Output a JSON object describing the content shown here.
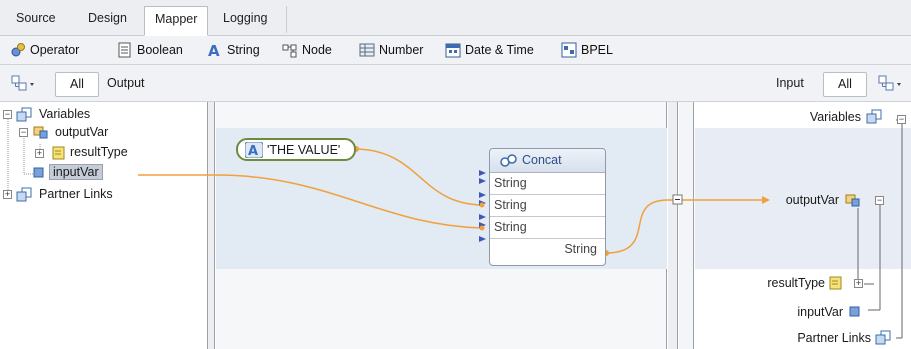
{
  "tabs": [
    "Source",
    "Design",
    "Mapper",
    "Logging"
  ],
  "palette": {
    "operator": "Operator",
    "boolean": "Boolean",
    "string": "String",
    "node": "Node",
    "number": "Number",
    "datetime": "Date & Time",
    "bpel": "BPEL"
  },
  "output_ctrl": {
    "all": "All",
    "label": "Output"
  },
  "input_ctrl": {
    "label": "Input",
    "all": "All"
  },
  "left_tree": {
    "variables": "Variables",
    "outputVar": "outputVar",
    "resultType": "resultType",
    "inputVar": "inputVar",
    "partner_links": "Partner Links"
  },
  "literal": {
    "value": "'THE VALUE'"
  },
  "concat": {
    "title": "Concat",
    "inputs": [
      "String",
      "String",
      "String"
    ],
    "output": "String"
  },
  "right_tree": {
    "variables": "Variables",
    "outputVar": "outputVar",
    "resultType": "resultType",
    "inputVar": "inputVar",
    "partner_links": "Partner Links"
  },
  "colors": {
    "wire": "#f0a03c",
    "selection": "#c5ccd6",
    "band": "#e2eaf4"
  }
}
